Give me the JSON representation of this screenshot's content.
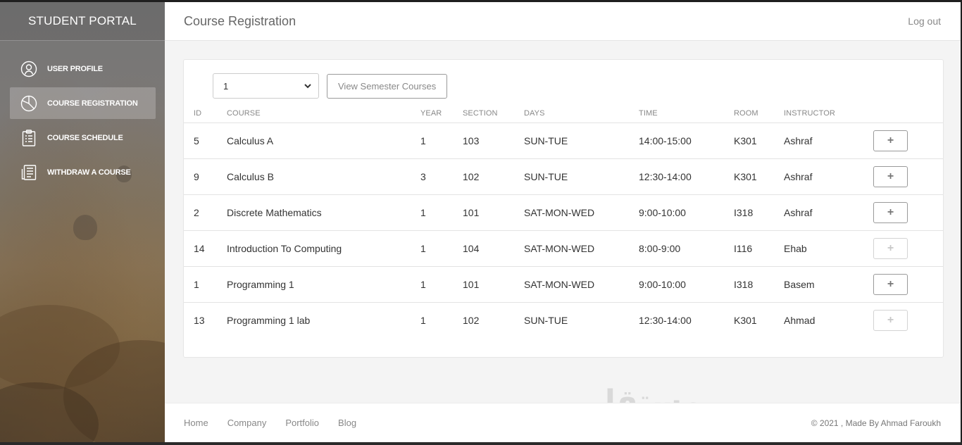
{
  "sidebar": {
    "brand": "STUDENT PORTAL",
    "items": [
      {
        "label": "USER PROFILE",
        "icon": "user-icon",
        "active": false
      },
      {
        "label": "COURSE REGISTRATION",
        "icon": "pie-chart-icon",
        "active": true
      },
      {
        "label": "COURSE SCHEDULE",
        "icon": "clipboard-icon",
        "active": false
      },
      {
        "label": "WITHDRAW A COURSE",
        "icon": "document-icon",
        "active": false
      }
    ]
  },
  "header": {
    "title": "Course Registration",
    "logout": "Log out"
  },
  "controls": {
    "semester_value": "1",
    "view_button": "View Semester Courses"
  },
  "table": {
    "columns": [
      "ID",
      "COURSE",
      "YEAR",
      "SECTION",
      "DAYS",
      "TIME",
      "ROOM",
      "INSTRUCTOR"
    ],
    "rows": [
      {
        "id": "5",
        "course": "Calculus A",
        "year": "1",
        "section": "103",
        "days": "SUN-TUE",
        "time": "14:00-15:00",
        "room": "K301",
        "instructor": "Ashraf",
        "add_enabled": true
      },
      {
        "id": "9",
        "course": "Calculus B",
        "year": "3",
        "section": "102",
        "days": "SUN-TUE",
        "time": "12:30-14:00",
        "room": "K301",
        "instructor": "Ashraf",
        "add_enabled": true
      },
      {
        "id": "2",
        "course": "Discrete Mathematics",
        "year": "1",
        "section": "101",
        "days": "SAT-MON-WED",
        "time": "9:00-10:00",
        "room": "I318",
        "instructor": "Ashraf",
        "add_enabled": true
      },
      {
        "id": "14",
        "course": "Introduction To Computing",
        "year": "1",
        "section": "104",
        "days": "SAT-MON-WED",
        "time": "8:00-9:00",
        "room": "I116",
        "instructor": "Ehab",
        "add_enabled": false
      },
      {
        "id": "1",
        "course": "Programming 1",
        "year": "1",
        "section": "101",
        "days": "SAT-MON-WED",
        "time": "9:00-10:00",
        "room": "I318",
        "instructor": "Basem",
        "add_enabled": true
      },
      {
        "id": "13",
        "course": "Programming 1 lab",
        "year": "1",
        "section": "102",
        "days": "SUN-TUE",
        "time": "12:30-14:00",
        "room": "K301",
        "instructor": "Ahmad",
        "add_enabled": false
      }
    ],
    "add_symbol": "+"
  },
  "footer": {
    "links": [
      "Home",
      "Company",
      "Portfolio",
      "Blog"
    ],
    "copyright": "© 2021 , Made By Ahmad Faroukh"
  },
  "watermark": {
    "arabic": "مستقل",
    "latin": "mostaql.com"
  }
}
